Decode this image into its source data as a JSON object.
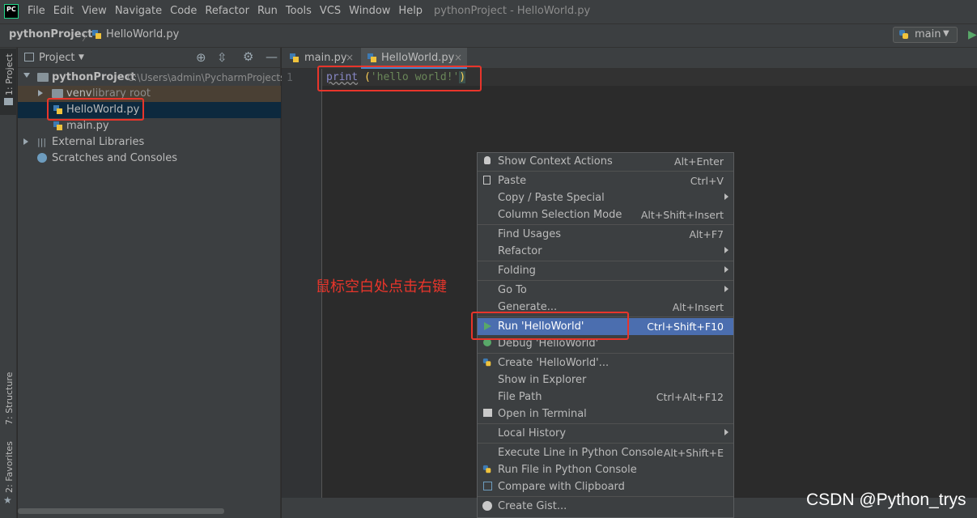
{
  "app": {
    "logo_text": "PC",
    "menu": [
      "File",
      "Edit",
      "View",
      "Navigate",
      "Code",
      "Refactor",
      "Run",
      "Tools",
      "VCS",
      "Window",
      "Help"
    ],
    "window_title": "pythonProject - HelloWorld.py"
  },
  "navbar": {
    "project": "pythonProject",
    "file": "HelloWorld.py",
    "run_config": "main"
  },
  "stripe": {
    "project": "1: Project",
    "structure": "7: Structure",
    "favorites": "2: Favorites"
  },
  "project_panel": {
    "title": "Project",
    "root": {
      "name": "pythonProject",
      "path": "C:\\Users\\admin\\PycharmProjects"
    },
    "venv": {
      "name": "venv",
      "hint": "library root"
    },
    "files": [
      "HelloWorld.py",
      "main.py"
    ],
    "external": "External Libraries",
    "scratches": "Scratches and Consoles"
  },
  "editor": {
    "tabs": [
      "main.py",
      "HelloWorld.py"
    ],
    "line_number": "1",
    "code": {
      "func": "print",
      "space": " ",
      "open": "(",
      "string": "'hello world!'",
      "close": ")"
    }
  },
  "annotation": "鼠标空白处点击右键",
  "context_menu": {
    "items": [
      {
        "label": "Show Context Actions",
        "shortcut": "Alt+Enter",
        "icon": "bulb-icon"
      },
      {
        "label": "Paste",
        "shortcut": "Ctrl+V",
        "icon": "paste-icon"
      },
      {
        "label": "Copy / Paste Special",
        "shortcut": ""
      },
      {
        "label": "Column Selection Mode",
        "shortcut": "Alt+Shift+Insert"
      },
      {
        "label": "Find Usages",
        "shortcut": "Alt+F7"
      },
      {
        "label": "Refactor",
        "shortcut": ""
      },
      {
        "label": "Folding",
        "shortcut": ""
      },
      {
        "label": "Go To",
        "shortcut": ""
      },
      {
        "label": "Generate...",
        "shortcut": "Alt+Insert"
      },
      {
        "label": "Run 'HelloWorld'",
        "shortcut": "Ctrl+Shift+F10",
        "icon": "run-icon"
      },
      {
        "label": "Debug 'HelloWorld'",
        "shortcut": "",
        "icon": "debug-icon"
      },
      {
        "label": "Create 'HelloWorld'...",
        "shortcut": "",
        "icon": "python-icon"
      },
      {
        "label": "Show in Explorer",
        "shortcut": ""
      },
      {
        "label": "File Path",
        "shortcut": "Ctrl+Alt+F12"
      },
      {
        "label": "Open in Terminal",
        "shortcut": "",
        "icon": "terminal-icon"
      },
      {
        "label": "Local History",
        "shortcut": ""
      },
      {
        "label": "Execute Line in Python Console",
        "shortcut": "Alt+Shift+E"
      },
      {
        "label": "Run File in Python Console",
        "shortcut": "",
        "icon": "python-console-icon"
      },
      {
        "label": "Compare with Clipboard",
        "shortcut": "",
        "icon": "compare-icon"
      },
      {
        "label": "Create Gist...",
        "shortcut": "",
        "icon": "github-icon"
      }
    ]
  },
  "watermark": "CSDN @Python_trys",
  "colors": {
    "accent": "#4b6eaf",
    "annotation_red": "#e8352b",
    "string_green": "#6a8759",
    "keyword_purple": "#8888c6"
  }
}
